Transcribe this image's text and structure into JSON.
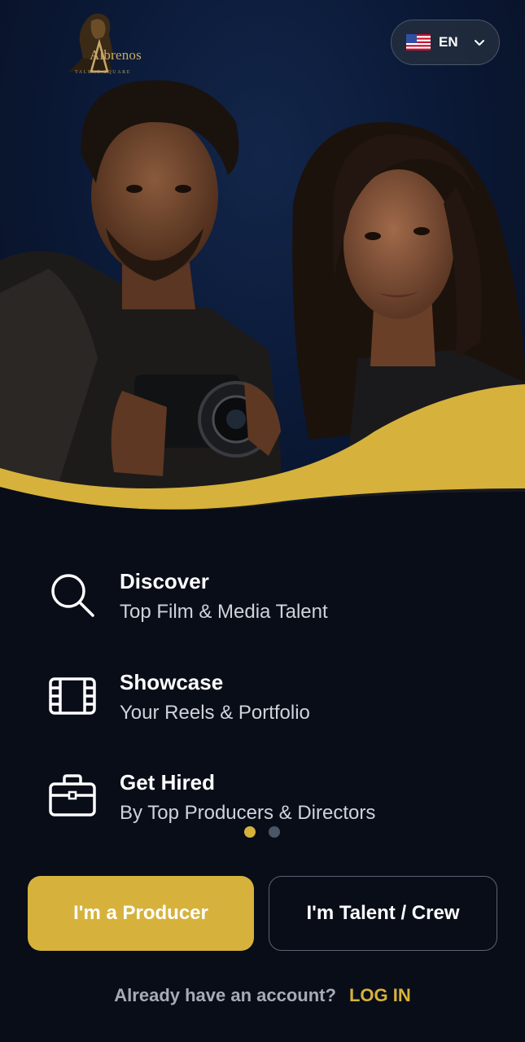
{
  "brand": {
    "name": "Albrenos",
    "tagline": "TALENT SQUARE"
  },
  "language": {
    "code": "EN",
    "flag_icon": "us-flag-icon"
  },
  "features": [
    {
      "icon": "search-icon",
      "title": "Discover",
      "subtitle": "Top Film & Media Talent"
    },
    {
      "icon": "film-icon",
      "title": "Showcase",
      "subtitle": "Your Reels & Portfolio"
    },
    {
      "icon": "briefcase-icon",
      "title": "Get Hired",
      "subtitle": "By Top Producers & Directors"
    }
  ],
  "carousel": {
    "total": 2,
    "active": 1
  },
  "actions": {
    "producer_label": "I'm a Producer",
    "talent_label": "I'm Talent / Crew"
  },
  "login": {
    "prompt": "Already have an account?",
    "link_label": "LOG IN"
  },
  "colors": {
    "accent": "#d6b23c",
    "background": "#080d18",
    "muted_text": "#a6abb5",
    "dot_inactive": "#4a5568"
  }
}
